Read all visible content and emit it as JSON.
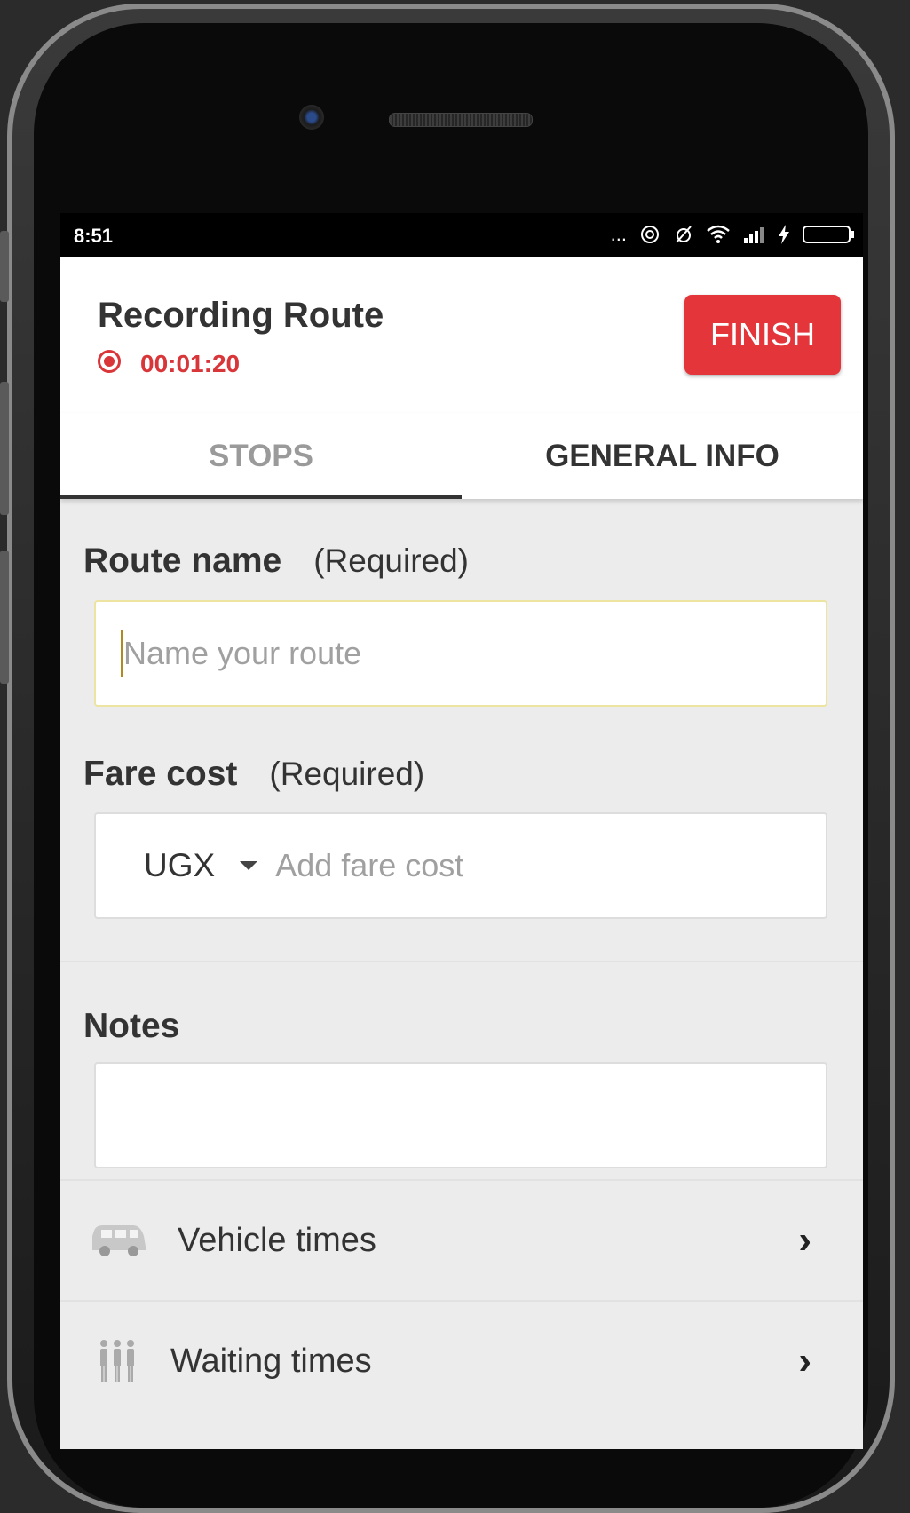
{
  "status_bar": {
    "time": "8:51",
    "more_icon": "...",
    "icons": [
      "hotspot-icon",
      "alarm-off-icon",
      "wifi-icon",
      "signal-icon",
      "charging-icon",
      "battery-icon"
    ]
  },
  "header": {
    "title": "Recording Route",
    "timer": "00:01:20",
    "finish_label": "FINISH"
  },
  "tabs": [
    {
      "label": "STOPS",
      "active": true
    },
    {
      "label": "GENERAL INFO",
      "active": false
    }
  ],
  "form": {
    "route_name": {
      "label": "Route name",
      "required": "(Required)",
      "placeholder": "Name your route",
      "value": ""
    },
    "fare_cost": {
      "label": "Fare cost",
      "required": "(Required)",
      "currency": "UGX",
      "placeholder": "Add fare cost",
      "value": ""
    },
    "notes": {
      "label": "Notes",
      "value": ""
    }
  },
  "list": [
    {
      "label": "Vehicle times",
      "icon": "van-icon"
    },
    {
      "label": "Waiting times",
      "icon": "people-icon"
    }
  ],
  "colors": {
    "accent": "#e3353a",
    "recording": "#d9363a",
    "background": "#ececec"
  }
}
